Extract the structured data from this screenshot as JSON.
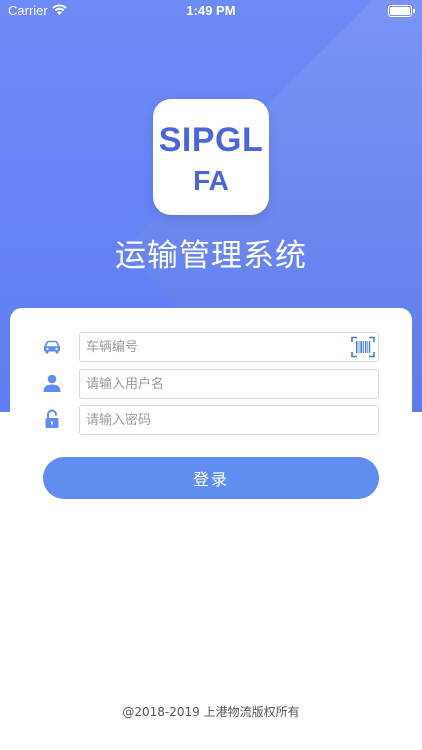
{
  "status_bar": {
    "carrier": "Carrier",
    "time": "1:49 PM"
  },
  "logo": {
    "line1": "SIPGL",
    "line2": "FA"
  },
  "app_title": "运输管理系统",
  "form": {
    "vehicle_placeholder": "车辆编号",
    "username_placeholder": "请输入用户名",
    "password_placeholder": "请输入密码",
    "vehicle_value": "",
    "username_value": "",
    "password_value": ""
  },
  "login_label": "登录",
  "footer": "@2018-2019 上港物流版权所有",
  "colors": {
    "primary": "#5f8df0",
    "hero": "#6d8af6",
    "icon": "#5f8df0"
  },
  "icons": [
    "car-icon",
    "user-icon",
    "lock-icon",
    "barcode-scan-icon",
    "wifi-icon",
    "battery-icon"
  ]
}
